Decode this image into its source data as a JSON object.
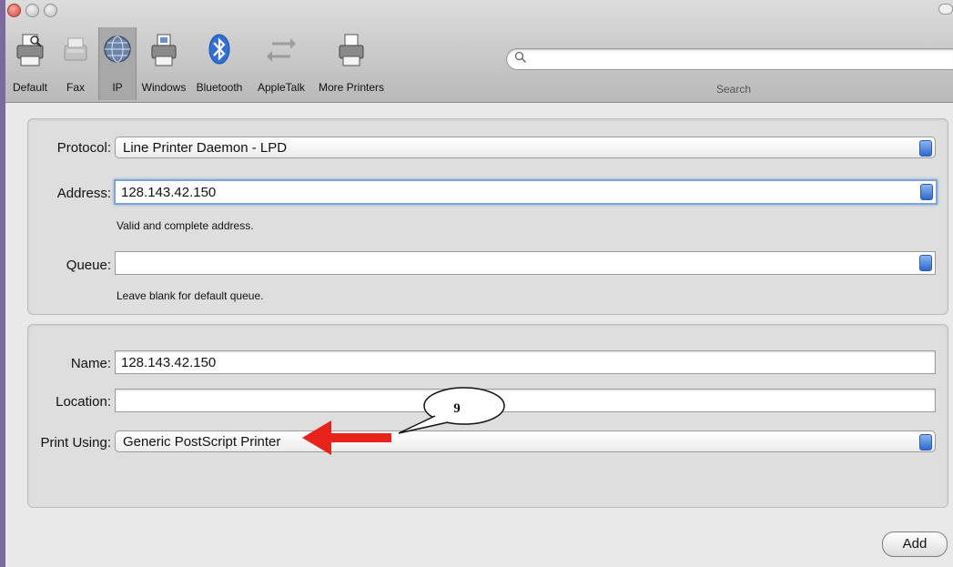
{
  "toolbar": {
    "items": [
      {
        "label": "Default",
        "icon": "printer-default-icon"
      },
      {
        "label": "Fax",
        "icon": "fax-icon"
      },
      {
        "label": "IP",
        "icon": "globe-icon"
      },
      {
        "label": "Windows",
        "icon": "windows-printer-icon"
      },
      {
        "label": "Bluetooth",
        "icon": "bluetooth-icon"
      },
      {
        "label": "AppleTalk",
        "icon": "appletalk-icon"
      },
      {
        "label": "More Printers",
        "icon": "more-printers-icon"
      }
    ],
    "selected": "IP",
    "search_caption": "Search",
    "search_value": ""
  },
  "connection": {
    "protocol_label": "Protocol:",
    "protocol_value": "Line Printer Daemon - LPD",
    "address_label": "Address:",
    "address_value": "128.143.42.150",
    "address_hint": "Valid and complete address.",
    "queue_label": "Queue:",
    "queue_value": "",
    "queue_hint": "Leave blank for default queue."
  },
  "details": {
    "name_label": "Name:",
    "name_value": "128.143.42.150",
    "location_label": "Location:",
    "location_value": "",
    "print_using_label": "Print Using:",
    "print_using_value": "Generic PostScript Printer"
  },
  "annotation": {
    "callout_number": "9",
    "arrow_color": "#e8231b"
  },
  "actions": {
    "add_label": "Add"
  },
  "colors": {
    "accent_blue": "#2d6bd0",
    "focus_ring": "#7fa6d9"
  }
}
